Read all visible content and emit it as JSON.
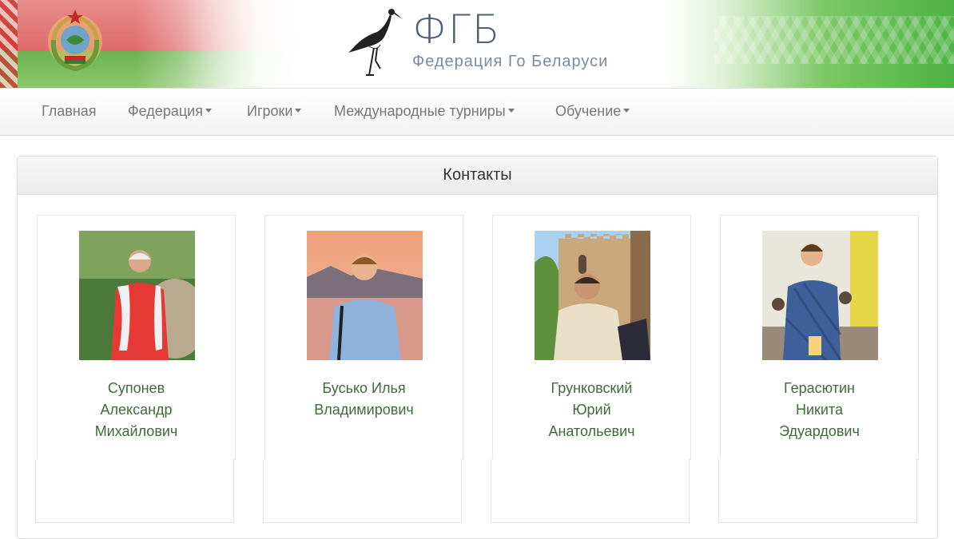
{
  "header": {
    "logo_title": "ФГБ",
    "logo_subtitle": "Федерация Го Беларуси",
    "emblem_icon": "belarus-emblem-icon",
    "stork_icon": "stork-logo-icon",
    "colors": {
      "flag_red": "#de6a6a",
      "flag_green": "#6bb34f",
      "logo_text": "#4f6076"
    }
  },
  "nav": {
    "items": [
      {
        "label": "Главная"
      },
      {
        "label": "Федерация"
      },
      {
        "label": "Игроки"
      },
      {
        "label": "Международные турниры"
      },
      {
        "label": "Обучение"
      }
    ]
  },
  "panel": {
    "title": "Контакты"
  },
  "contacts": [
    {
      "name_lines": [
        "Супонев",
        "Александр",
        "Михайлович"
      ]
    },
    {
      "name_lines": [
        "Бусько Илья",
        "Владимирович"
      ]
    },
    {
      "name_lines": [
        "Грунковский",
        "Юрий",
        "Анатольевич"
      ]
    },
    {
      "name_lines": [
        "Герасютин",
        "Никита",
        "Эдуардович"
      ]
    }
  ],
  "colors": {
    "name_link": "#3f6b3a",
    "nav_text": "#777777"
  }
}
